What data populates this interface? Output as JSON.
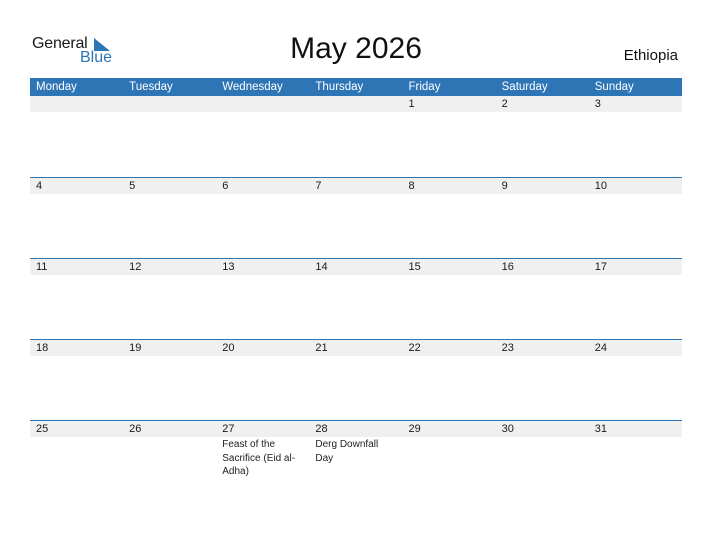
{
  "logo": {
    "general": "General",
    "blue": "Blue",
    "brand_color": "#2e75b6"
  },
  "title": "May 2026",
  "country": "Ethiopia",
  "weekdays": [
    "Monday",
    "Tuesday",
    "Wednesday",
    "Thursday",
    "Friday",
    "Saturday",
    "Sunday"
  ],
  "weeks": [
    {
      "days": [
        "",
        "",
        "",
        "",
        "1",
        "2",
        "3"
      ],
      "events": [
        "",
        "",
        "",
        "",
        "",
        "",
        ""
      ]
    },
    {
      "days": [
        "4",
        "5",
        "6",
        "7",
        "8",
        "9",
        "10"
      ],
      "events": [
        "",
        "",
        "",
        "",
        "",
        "",
        ""
      ]
    },
    {
      "days": [
        "11",
        "12",
        "13",
        "14",
        "15",
        "16",
        "17"
      ],
      "events": [
        "",
        "",
        "",
        "",
        "",
        "",
        ""
      ]
    },
    {
      "days": [
        "18",
        "19",
        "20",
        "21",
        "22",
        "23",
        "24"
      ],
      "events": [
        "",
        "",
        "",
        "",
        "",
        "",
        ""
      ]
    },
    {
      "days": [
        "25",
        "26",
        "27",
        "28",
        "29",
        "30",
        "31"
      ],
      "events": [
        "",
        "",
        "Feast of the Sacrifice (Eid al-Adha)",
        "Derg Downfall Day",
        "",
        "",
        ""
      ]
    }
  ]
}
